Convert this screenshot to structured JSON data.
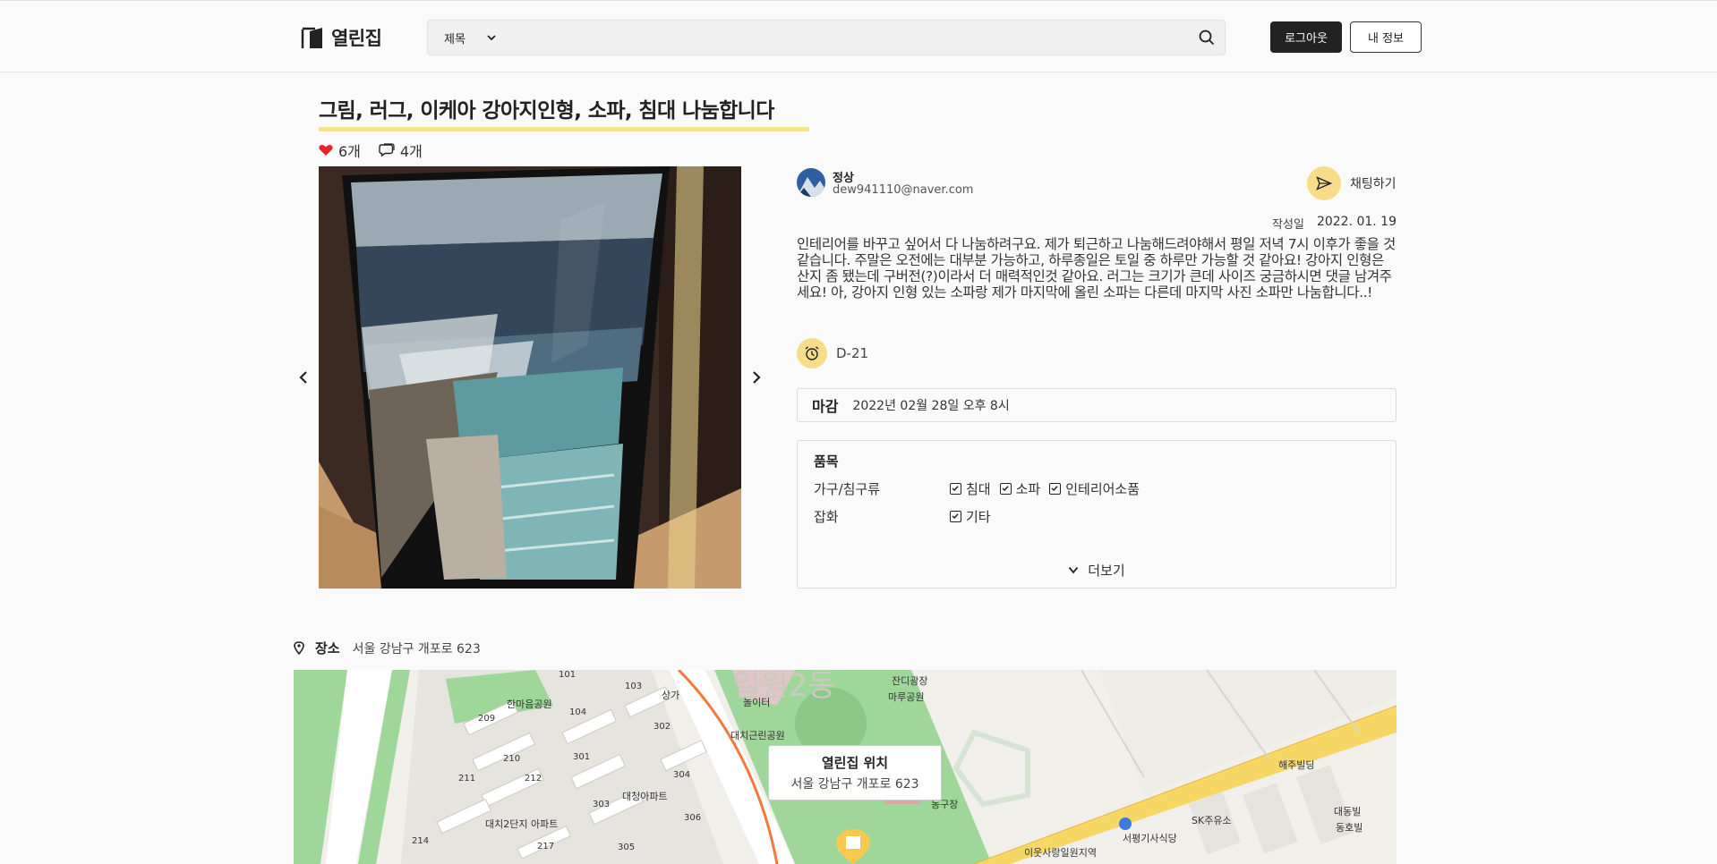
{
  "header": {
    "logo_text": "열린집",
    "search_select": "제목",
    "search_placeholder": "",
    "logout_label": "로그아웃",
    "myinfo_label": "내 정보"
  },
  "post": {
    "title": "그림, 러그, 이케아 강아지인형, 소파, 침대 나눔합니다",
    "likes": "6개",
    "comments": "4개",
    "author_name": "정상",
    "author_email": "dew941110@naver.com",
    "chat_label": "채팅하기",
    "date_label": "작성일",
    "date_value": "2022. 01. 19",
    "description": "인테리어를 바꾸고 싶어서 다 나눔하려구요. 제가 퇴근하고 나눔해드려야해서 평일 저녁 7시 이후가 좋을 것 같습니다. 주말은 오전에는 대부분 가능하고, 하루종일은 토일 중 하루만 가능할 것 같아요! 강아지 인형은 산지 좀 됐는데 구버전(?)이라서 더 매력적인것 같아요. 러그는 크기가 큰데 사이즈 궁금하시면 댓글 남겨주세요! 아, 강아지 인형 있는 소파랑 제가 마지막에 올린 소파는 다른데 마지막 사진 소파만 나눔합니다..!",
    "dday": "D-21",
    "deadline_label": "마감",
    "deadline_value": "2022년 02월 28일 오후 8시",
    "items_title": "품목",
    "item_rows": [
      {
        "category": "가구/침구류",
        "items": [
          "침대",
          "소파",
          "인테리어소품"
        ]
      },
      {
        "category": "잡화",
        "items": [
          "기타"
        ]
      }
    ],
    "more_label": "더보기"
  },
  "location": {
    "label": "장소",
    "address": "서울 강남구 개포로 623",
    "popup_title": "열린집 위치",
    "popup_address": "서울 강남구 개포로 623",
    "map_labels": [
      {
        "text": "한마음공원"
      },
      {
        "text": "대치근린공원"
      },
      {
        "text": "대청아파트"
      },
      {
        "text": "대치2단지 아파트"
      },
      {
        "text": "잔디광장"
      },
      {
        "text": "마루공원"
      },
      {
        "text": "놀이터"
      },
      {
        "text": "상가"
      },
      {
        "text": "해주빌딩"
      },
      {
        "text": "SK주유소"
      },
      {
        "text": "서평기사식당"
      },
      {
        "text": "이웃사랑일원지역"
      },
      {
        "text": "대동빌"
      },
      {
        "text": "동호빌"
      },
      {
        "text": "동구장"
      },
      {
        "text": "일원2동"
      }
    ],
    "building_numbers": [
      "101",
      "103",
      "104",
      "209",
      "210",
      "211",
      "212",
      "214",
      "217",
      "301",
      "302",
      "303",
      "304",
      "305",
      "306"
    ],
    "zoom_plus": "+",
    "zoom_minus": "−"
  },
  "colors": {
    "accent_yellow": "#f7dc8a",
    "underline_yellow": "#f7e08f",
    "heart_red": "#e8212e",
    "dark": "#222222",
    "map_green": "#9fd69a",
    "road_yellow": "#f6d766",
    "zoom_blue": "#3c7be0"
  },
  "icons": {
    "logo": "door-icon",
    "search": "search-icon",
    "like": "heart-icon",
    "comment": "comment-icon",
    "chat": "send-icon",
    "alarm": "alarm-clock-icon",
    "location": "pin-icon",
    "prev": "chevron-left-icon",
    "next": "chevron-right-icon",
    "more": "chevron-down-icon"
  }
}
